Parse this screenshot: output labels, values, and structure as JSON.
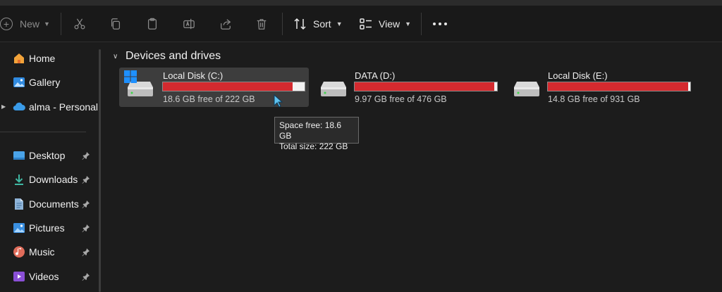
{
  "toolbar": {
    "new_label": "New",
    "sort_label": "Sort",
    "view_label": "View",
    "icons": [
      "cut-icon",
      "copy-icon",
      "paste-icon",
      "rename-icon",
      "share-icon",
      "delete-icon",
      "sort-icon",
      "view-icon",
      "more-icon"
    ]
  },
  "sidebar": {
    "items": [
      {
        "label": "Home",
        "icon": "home-icon"
      },
      {
        "label": "Gallery",
        "icon": "gallery-icon"
      },
      {
        "label": "alma - Personal",
        "icon": "cloud-icon"
      },
      {
        "label": "Desktop",
        "icon": "desktop-icon",
        "pinned": true
      },
      {
        "label": "Downloads",
        "icon": "download-icon",
        "pinned": true
      },
      {
        "label": "Documents",
        "icon": "documents-icon",
        "pinned": true
      },
      {
        "label": "Pictures",
        "icon": "pictures-icon",
        "pinned": true
      },
      {
        "label": "Music",
        "icon": "music-icon",
        "pinned": true
      },
      {
        "label": "Videos",
        "icon": "videos-icon",
        "pinned": true
      }
    ]
  },
  "section": {
    "title": "Devices and drives"
  },
  "drives": [
    {
      "name": "Local Disk (C:)",
      "free_text": "18.6 GB free of 222 GB",
      "used_fraction": 0.916,
      "selected": true,
      "system": true
    },
    {
      "name": "DATA (D:)",
      "free_text": "9.97 GB free of 476 GB",
      "used_fraction": 0.979,
      "selected": false,
      "system": false
    },
    {
      "name": "Local Disk (E:)",
      "free_text": "14.8 GB free of 931 GB",
      "used_fraction": 0.984,
      "selected": false,
      "system": false
    }
  ],
  "tooltip": {
    "line1": "Space free: 18.6 GB",
    "line2": "Total size: 222 GB"
  },
  "colors": {
    "accent": "#0078d4",
    "bar_fill": "#d42a2f",
    "bar_track": "#f2f2f2",
    "background": "#1c1c1c"
  }
}
